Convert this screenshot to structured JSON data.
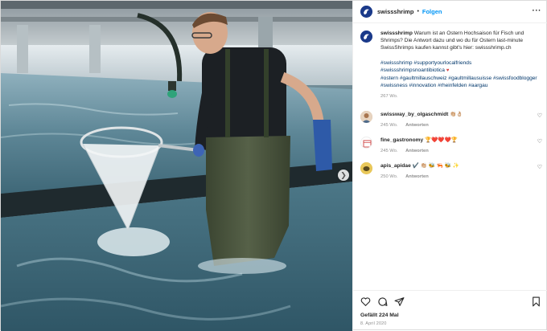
{
  "post": {
    "username": "swissshrimp",
    "separator": "•",
    "follow_label": "Folgen",
    "more_label": "···",
    "caption_text": "Warum ist an Ostern Hochsaison für Fisch und Shrimps? Die Antwort dazu und wo du für Ostern last-minute SwissShrimps kaufen kannst gibt's hier: swissshrimp.ch",
    "hashtags_line1": "#swissshrimp #supportyourlocalfriends",
    "hashtags_line2": "#swissshrimpsnoantibiotica",
    "hashtags_line3": "#ostern #gaultmillauschweiz #gaultmillausuisse #swissfoodblogger #swissness #innovation #rheinfelden #aargau",
    "caption_time": "267 Wo.",
    "likes": "Gefällt 224 Mal",
    "date": "8. April 2020"
  },
  "comments": [
    {
      "user": "swissway_by_olgaschmidt",
      "text": "👏🏼👌🏼",
      "time": "245 Wo.",
      "reply": "Antworten",
      "avatar_color": "#c9a27e"
    },
    {
      "user": "fine_gastronomy",
      "text": "🏆❤️❤️❤️🏆",
      "time": "245 Wo.",
      "reply": "Antworten",
      "avatar_color": "#ffffff"
    },
    {
      "user": "apis_apidae",
      "text": "✔️ 👏🏼 🐝 🦐 🐝 ✨",
      "time": "250 Wo.",
      "reply": "Antworten",
      "avatar_color": "#d6b44a"
    }
  ],
  "icons": {
    "like": "heart-icon",
    "comment": "comment-icon",
    "share": "share-icon",
    "save": "bookmark-icon",
    "next": "chevron-right-icon"
  },
  "colors": {
    "accent_link": "#0095f6",
    "hashtag": "#00376b",
    "meta": "#8e8e8e"
  }
}
